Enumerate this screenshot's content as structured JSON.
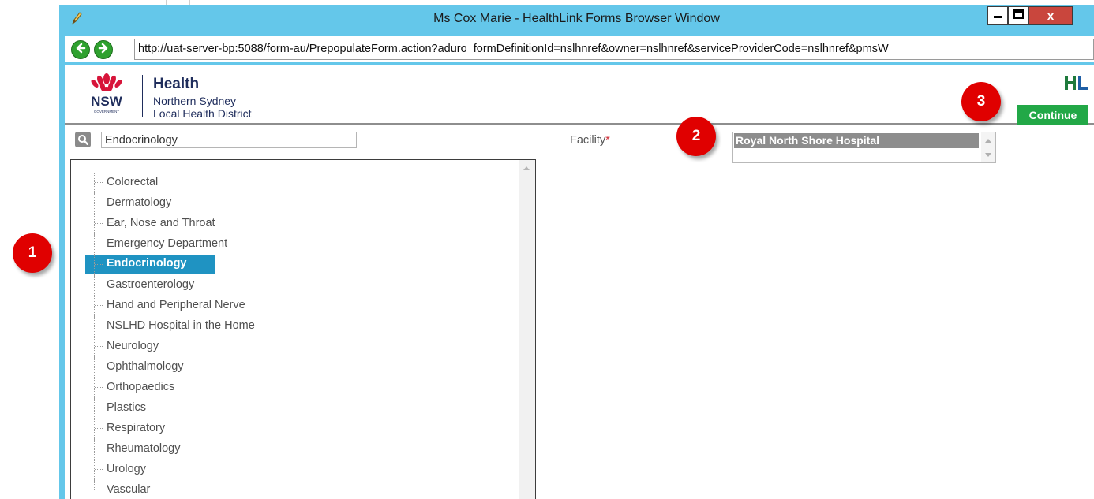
{
  "window": {
    "title": "Ms Cox Marie - HealthLink Forms Browser Window",
    "controls": {
      "minimize": "minimize-icon",
      "maximize": "maximize-icon",
      "close": "x"
    }
  },
  "navigation": {
    "back_icon": "arrow-left-icon",
    "forward_icon": "arrow-right-icon",
    "url": "http://uat-server-bp:5088/form-au/PrepopulateForm.action?aduro_formDefinitionId=nslhnref&owner=nslhnref&serviceProviderCode=nslhnref&pmsW"
  },
  "header": {
    "logo_text": "NSW",
    "logo_sub": "GOVERNMENT",
    "org_name": "Health",
    "org_line1": "Northern Sydney",
    "org_line2": "Local Health District",
    "brand_logo": "HL",
    "continue_label": "Continue"
  },
  "search": {
    "value": "Endocrinology",
    "icon": "search-icon"
  },
  "specialties": {
    "items": [
      {
        "label": "Colorectal",
        "selected": false
      },
      {
        "label": "Dermatology",
        "selected": false
      },
      {
        "label": "Ear, Nose and Throat",
        "selected": false
      },
      {
        "label": "Emergency Department",
        "selected": false
      },
      {
        "label": "Endocrinology",
        "selected": true
      },
      {
        "label": "Gastroenterology",
        "selected": false
      },
      {
        "label": "Hand and Peripheral Nerve",
        "selected": false
      },
      {
        "label": "NSLHD Hospital in the Home",
        "selected": false
      },
      {
        "label": "Neurology",
        "selected": false
      },
      {
        "label": "Ophthalmology",
        "selected": false
      },
      {
        "label": "Orthopaedics",
        "selected": false
      },
      {
        "label": "Plastics",
        "selected": false
      },
      {
        "label": "Respiratory",
        "selected": false
      },
      {
        "label": "Rheumatology",
        "selected": false
      },
      {
        "label": "Urology",
        "selected": false
      },
      {
        "label": "Vascular",
        "selected": false
      }
    ]
  },
  "facility": {
    "label": "Facility",
    "required_marker": "*",
    "options": [
      "Royal North Shore Hospital",
      ""
    ],
    "selected": "Royal North Shore Hospital"
  },
  "callouts": [
    "1",
    "2",
    "3"
  ],
  "colors": {
    "window_frame": "#64c7ea",
    "selection": "#1f93c2",
    "continue_button": "#22a847",
    "callout": "#e00000"
  }
}
